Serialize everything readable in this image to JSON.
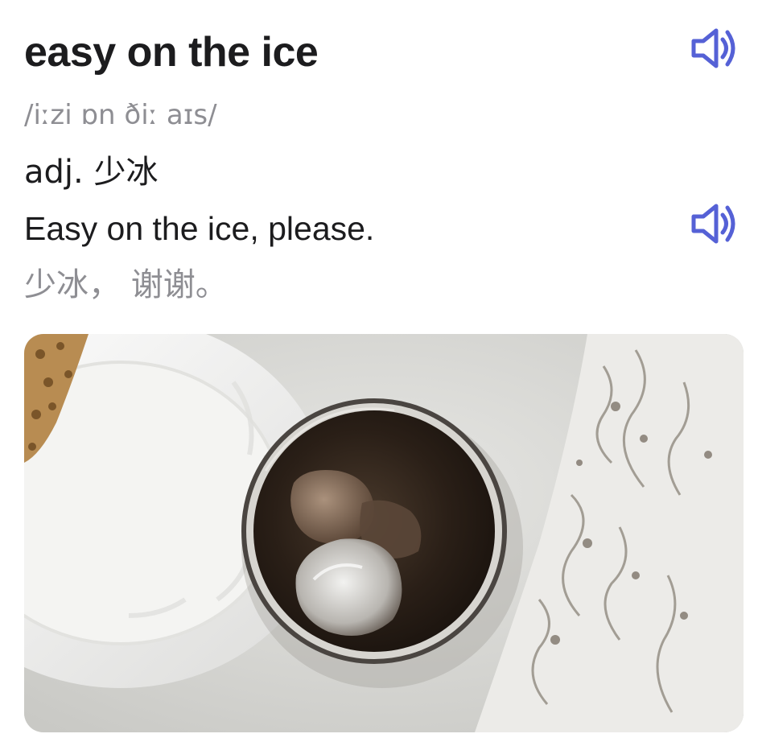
{
  "entry": {
    "word": "easy on the ice",
    "phonetic": "/iːzi ɒn ðiː aɪs/",
    "part_of_speech": "adj.",
    "meaning": "少冰"
  },
  "example": {
    "english": "Easy on the ice, please.",
    "chinese": "少冰， 谢谢。"
  },
  "icons": {
    "word_audio": "speaker-icon",
    "example_audio": "speaker-icon"
  },
  "colors": {
    "accent": "#5561d6",
    "secondary_text": "#8e8e93",
    "primary_text": "#1c1c1e"
  },
  "image": {
    "subject": "iced-coffee-photo"
  }
}
